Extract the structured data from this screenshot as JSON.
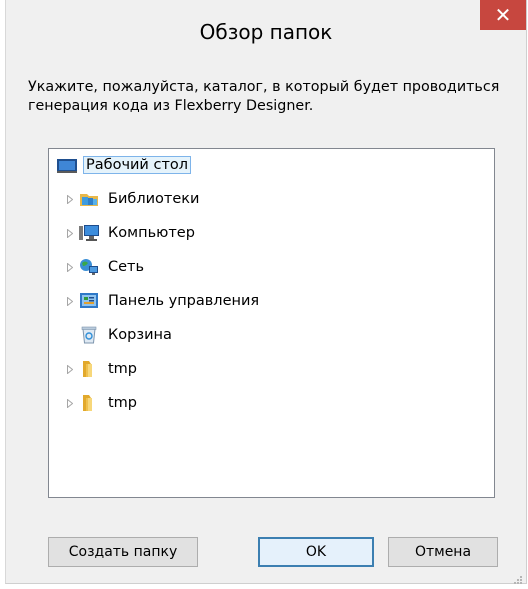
{
  "window": {
    "title": "Обзор папок",
    "close_glyph": "✕"
  },
  "instructions": "Укажите, пожалуйста, каталог, в который будет проводиться генерация кода из Flexberry Designer.",
  "tree": {
    "items": [
      {
        "label": "Рабочий стол",
        "icon": "desktop-icon",
        "expandable": false,
        "selected": true,
        "level": 0
      },
      {
        "label": "Библиотеки",
        "icon": "libraries-icon",
        "expandable": true,
        "selected": false,
        "level": 1
      },
      {
        "label": "Компьютер",
        "icon": "computer-icon",
        "expandable": true,
        "selected": false,
        "level": 1
      },
      {
        "label": "Сеть",
        "icon": "network-icon",
        "expandable": true,
        "selected": false,
        "level": 1
      },
      {
        "label": "Панель управления",
        "icon": "control-panel-icon",
        "expandable": true,
        "selected": false,
        "level": 1
      },
      {
        "label": "Корзина",
        "icon": "recycle-bin-icon",
        "expandable": false,
        "selected": false,
        "level": 1
      },
      {
        "label": "tmp",
        "icon": "folder-icon",
        "expandable": true,
        "selected": false,
        "level": 1
      },
      {
        "label": "tmp",
        "icon": "folder-icon",
        "expandable": true,
        "selected": false,
        "level": 1
      }
    ]
  },
  "buttons": {
    "new_folder": "Создать папку",
    "ok": "OK",
    "cancel": "Отмена"
  },
  "colors": {
    "close_button": "#c7473f",
    "dialog_bg": "#f0f0f0",
    "selection_border": "#7eb4ea",
    "selection_fill": "#e5f3fb",
    "default_button_border": "#3c7fb1"
  }
}
